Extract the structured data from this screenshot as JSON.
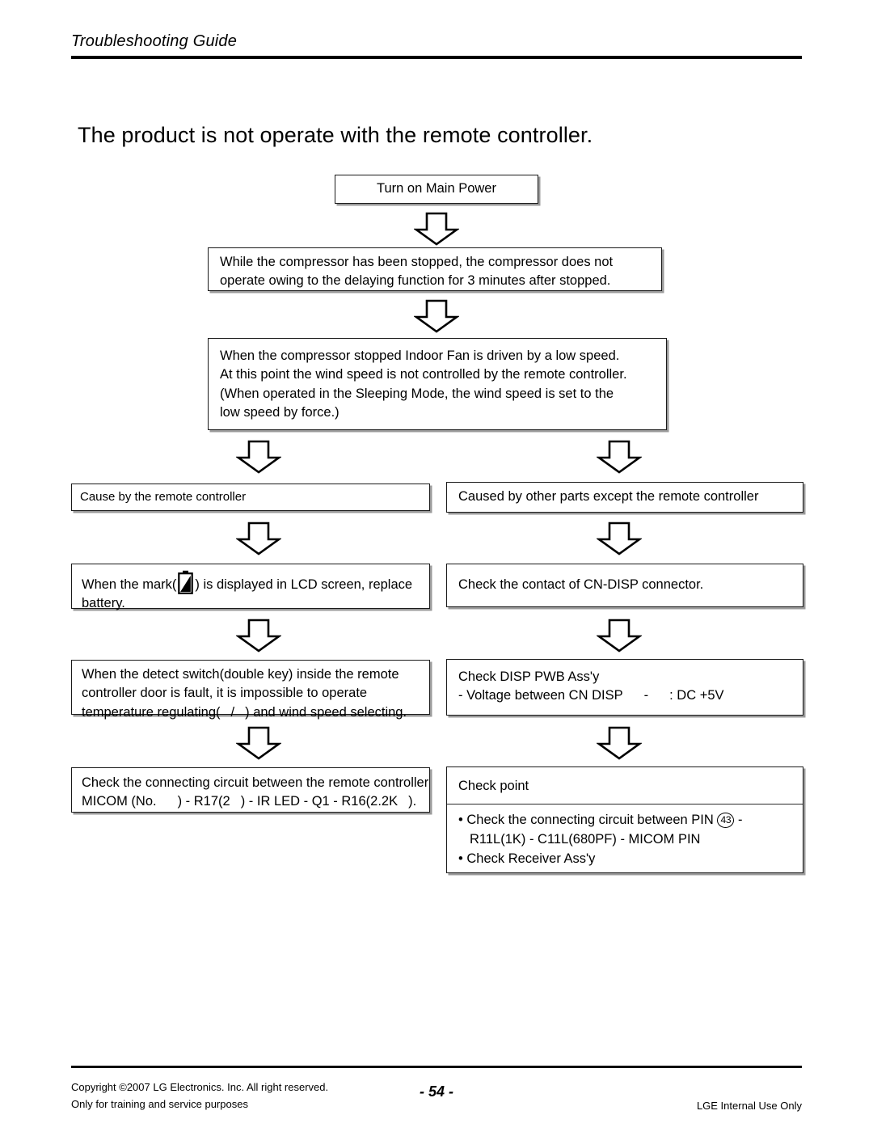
{
  "header": {
    "title": "Troubleshooting Guide"
  },
  "page_title": "The product is not operate with the remote controller.",
  "flow": {
    "power": {
      "label": "Turn on Main Power"
    },
    "compressor": {
      "line1": "While the compressor has been stopped, the compressor does not",
      "line2": "operate owing to the delaying function for 3 minutes after stopped."
    },
    "fan": {
      "line1": "When the compressor stopped Indoor Fan is driven by a low speed.",
      "line2": "At this point the wind speed is not controlled by the remote controller.",
      "line3": "(When operated in the Sleeping Mode, the wind speed is set to the",
      "line4": "low speed by force.)"
    },
    "cause_left": {
      "label": "Cause by the remote controller"
    },
    "cause_right": {
      "label": "Caused by other parts except the remote controller"
    },
    "battery": {
      "pre": "When the mark(",
      "post": ") is displayed in LCD screen, replace",
      "line2": "battery."
    },
    "cndisp": {
      "label": "Check the contact of CN-DISP connector."
    },
    "detect": {
      "line1": "When the detect switch(double key) inside the remote",
      "line2": "controller door is fault, it is impossible to operate",
      "line3_pre": "temperature regulating(",
      "line3_sep": "/",
      "line3_post": ") and wind speed selecting."
    },
    "disp_pwb": {
      "line1": "Check DISP PWB Ass'y",
      "line2_pre": "- Voltage between CN DISP",
      "line2_dash": "-",
      "line2_post": ": DC +5V"
    },
    "micom": {
      "line1": "Check the connecting circuit between the remote controller",
      "line2_a": "MICOM (No.",
      "line2_b": ") - R17(2",
      "line2_c": ") - IR LED - Q1 - R16(2.2K",
      "line2_d": ")."
    },
    "checkpoint": {
      "heading": "Check point",
      "bullet1_pre": "• Check the connecting circuit between PIN",
      "bullet1_pin": "43",
      "bullet1_post": "-",
      "bullet1_cont": "R11L(1K) - C11L(680PF) - MICOM PIN",
      "bullet2": "• Check Receiver Ass'y"
    }
  },
  "footer": {
    "copyright_line1": "Copyright ©2007 LG Electronics. Inc. All right reserved.",
    "copyright_line2": "Only for training and service purposes",
    "page_number": "- 54 -",
    "notice": "LGE Internal Use Only"
  },
  "colors": {
    "ink": "#000000",
    "box_border": "#1a1a1a",
    "box_shadow": "#9a9a9a",
    "paper": "#ffffff"
  }
}
